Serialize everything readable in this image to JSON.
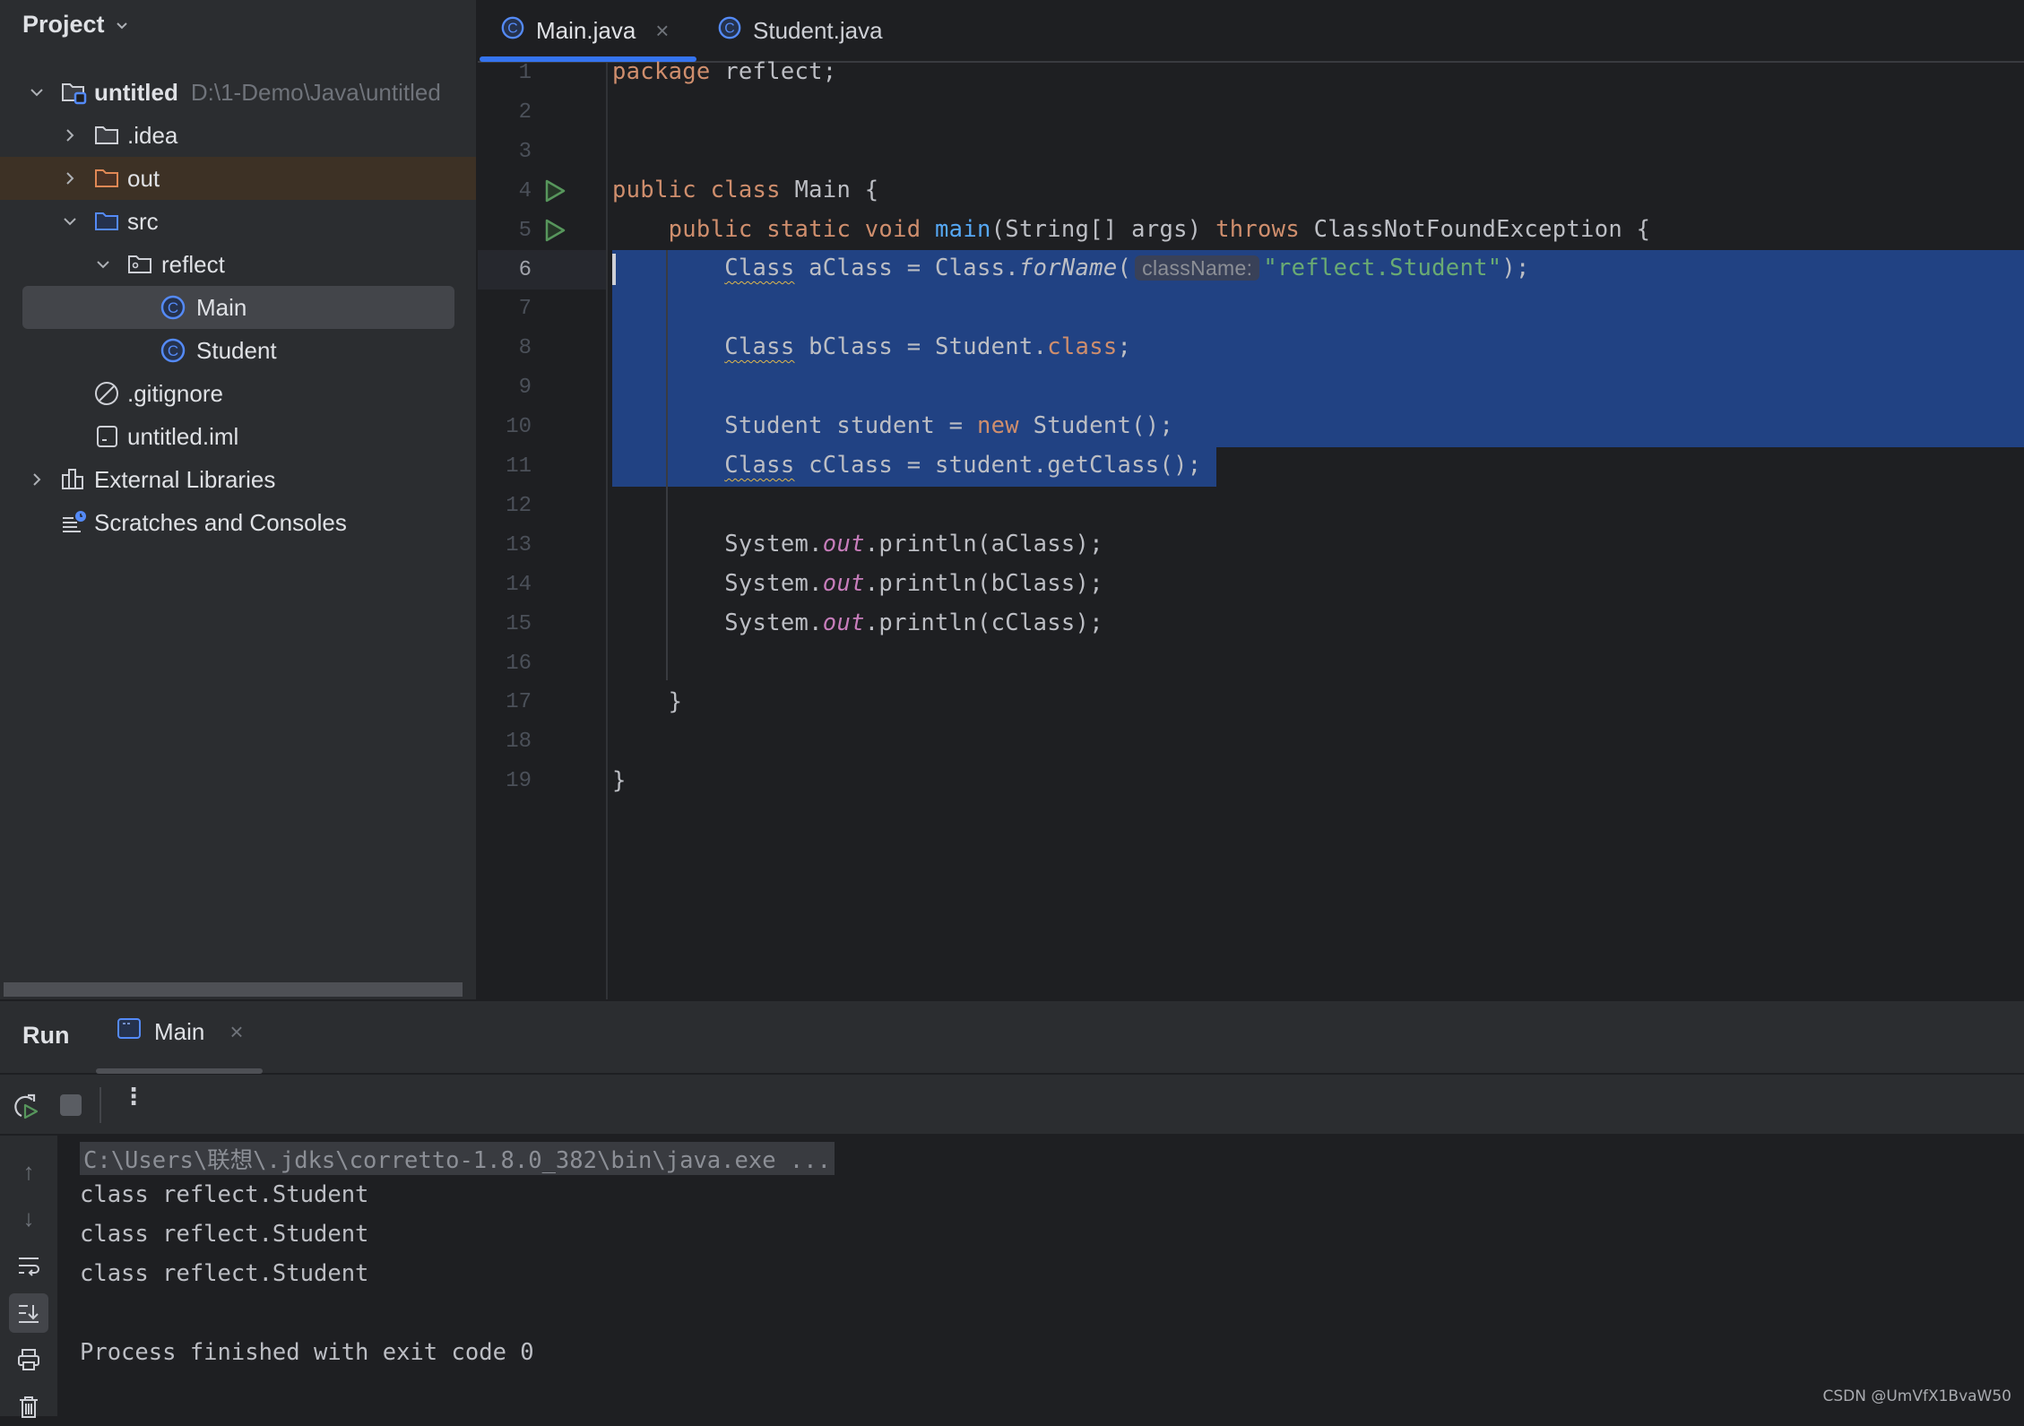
{
  "project_panel": {
    "title": "Project",
    "tree": [
      {
        "label": "untitled",
        "path": "D:\\1-Demo\\Java\\untitled",
        "icon": "module-folder-icon",
        "expanded": true
      },
      {
        "label": ".idea",
        "icon": "folder-icon",
        "expanded": false
      },
      {
        "label": "out",
        "icon": "excluded-folder-icon",
        "expanded": false
      },
      {
        "label": "src",
        "icon": "source-folder-icon",
        "expanded": true
      },
      {
        "label": "reflect",
        "icon": "package-icon",
        "expanded": true
      },
      {
        "label": "Main",
        "icon": "class-icon",
        "selected": true
      },
      {
        "label": "Student",
        "icon": "class-icon"
      },
      {
        "label": ".gitignore",
        "icon": "ignore-file-icon"
      },
      {
        "label": "untitled.iml",
        "icon": "iml-file-icon"
      },
      {
        "label": "External Libraries",
        "icon": "libraries-icon",
        "expanded": false
      },
      {
        "label": "Scratches and Consoles",
        "icon": "scratches-icon"
      }
    ]
  },
  "editor": {
    "tabs": [
      {
        "label": "Main.java",
        "active": true,
        "closable": true
      },
      {
        "label": "Student.java",
        "active": false
      }
    ],
    "current_line": 6,
    "line_numbers": [
      "1",
      "2",
      "3",
      "4",
      "5",
      "6",
      "7",
      "8",
      "9",
      "10",
      "11",
      "12",
      "13",
      "14",
      "15",
      "16",
      "17",
      "18",
      "19"
    ],
    "code": {
      "l1_kw": "package",
      "l1_rest": " reflect;",
      "l4_kw1": "public",
      "l4_kw2": "class",
      "l4_rest": " Main {",
      "l5_kw1": "public",
      "l5_kw2": "static",
      "l5_kw3": "void",
      "l5_fn": "main",
      "l5_mid": "(String[] args) ",
      "l5_kw4": "throws",
      "l5_rest": " ClassNotFoundException {",
      "l6_type": "Class",
      "l6_a": " aClass = Class.",
      "l6_method": "forName",
      "l6_paren": "(",
      "l6_hint": "className:",
      "l6_str": "\"reflect.Student\"",
      "l6_end": ");",
      "l8_type": "Class",
      "l8_a": " bClass = Student.",
      "l8_kw": "class",
      "l8_end": ";",
      "l10_a": "Student student = ",
      "l10_kw": "new",
      "l10_end": " Student();",
      "l11_type": "Class",
      "l11_a": " cClass = student.getClass();",
      "l13_a": "System.",
      "l13_out": "out",
      "l13_end": ".println(aClass);",
      "l14_a": "System.",
      "l14_out": "out",
      "l14_end": ".println(bClass);",
      "l15_a": "System.",
      "l15_out": "out",
      "l15_end": ".println(cClass);",
      "l17": "}",
      "l19": "}"
    }
  },
  "run_panel": {
    "title": "Run",
    "tab_label": "Main",
    "console": [
      "C:\\Users\\联想\\.jdks\\corretto-1.8.0_382\\bin\\java.exe ...",
      "class reflect.Student",
      "class reflect.Student",
      "class reflect.Student",
      "",
      "Process finished with exit code 0"
    ]
  },
  "watermark": "CSDN @UmVfX1BvaW50",
  "colors": {
    "accent": "#3574f0",
    "selection": "#214283",
    "keyword": "#cf8e6d",
    "string": "#6aab73",
    "function": "#56a8f5",
    "static_field": "#c77dbb"
  }
}
